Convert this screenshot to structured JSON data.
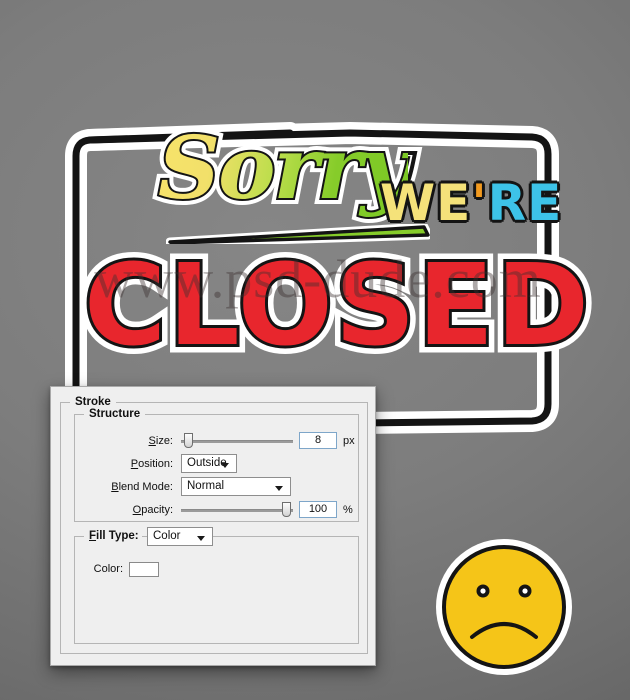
{
  "background": {
    "color": "#7b7b7b"
  },
  "sign": {
    "word_sorry": "Sorry",
    "word_were": "WE'RE",
    "word_were_parts": {
      "we": "WE",
      "apostrophe": "'",
      "re": "RE"
    },
    "word_closed": "CLOSED",
    "colors": {
      "sorry_gradient_start": "#f7e36a",
      "sorry_gradient_end": "#7ac824",
      "swoosh": "#86cc2a",
      "we": "#f5e27a",
      "apostrophe": "#f29a1f",
      "re": "#3dc3e8",
      "closed_fill": "#e8262d",
      "outline": "#141414",
      "halo": "#ffffff"
    }
  },
  "watermark": {
    "text": "www.psd-dude.com"
  },
  "sad_face": {
    "label": "sad-face-sticker",
    "fill": "#f5c518",
    "outline": "#141414",
    "halo": "#ffffff"
  },
  "dialog": {
    "group_stroke_label": "Stroke",
    "group_structure_label": "Structure",
    "group_filltype_label": "Fill Type:",
    "fields": {
      "size": {
        "label": "Size:",
        "label_accel": "S",
        "label_rest": "ize:",
        "value": "8",
        "unit": "px",
        "slider_percent": 5
      },
      "position": {
        "label": "Position:",
        "label_accel": "P",
        "label_rest": "osition:",
        "value": "Outside"
      },
      "blend_mode": {
        "label": "Blend Mode:",
        "label_accel": "B",
        "label_rest": "lend Mode:",
        "value": "Normal"
      },
      "opacity": {
        "label": "Opacity:",
        "label_accel": "O",
        "label_rest": "pacity:",
        "value": "100",
        "unit": "%",
        "slider_percent": 100
      },
      "fill_type": {
        "label": "Fill Type:",
        "label_accel": "F",
        "label_rest": "ill Type:",
        "value": "Color"
      },
      "color": {
        "label": "Color:",
        "swatch_color": "#ffffff"
      }
    }
  }
}
